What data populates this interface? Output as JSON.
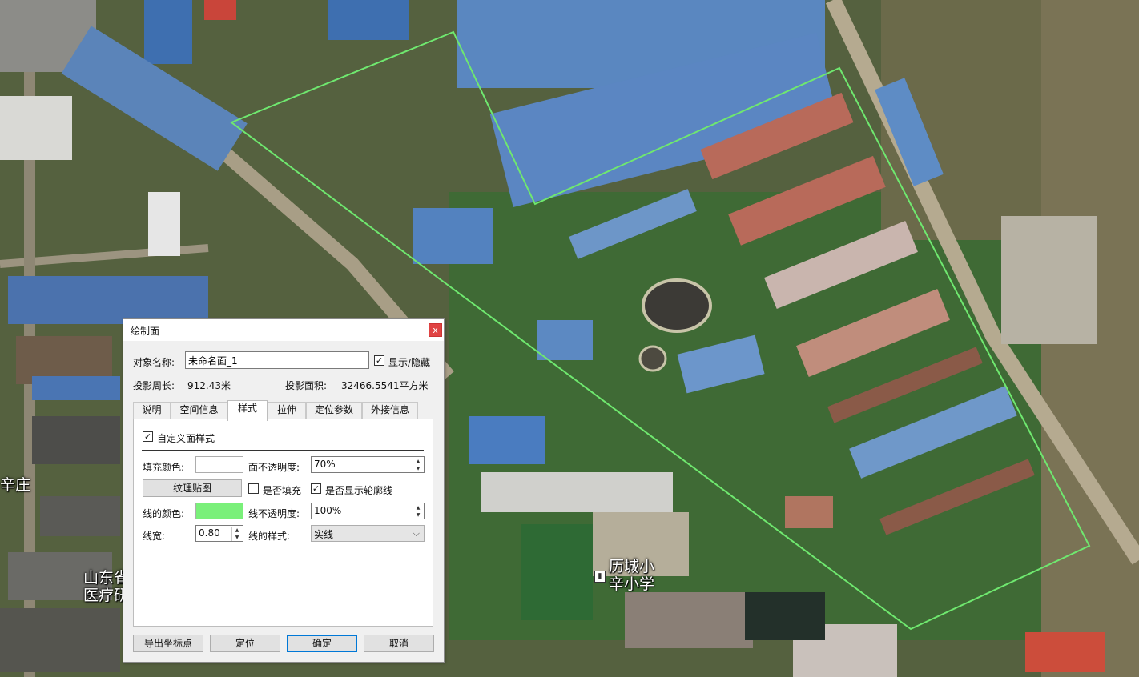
{
  "map": {
    "labels": {
      "school": "历城小\n辛小学",
      "left_place": "辛庄",
      "institute": "山东省\n医疗研"
    },
    "polygon_color": "#6fe86f"
  },
  "dialog": {
    "title": "绘制面",
    "close_label": "x",
    "name_label": "对象名称:",
    "name_value": "未命名面_1",
    "show_hide_label": "显示/隐藏",
    "perimeter_label": "投影周长:",
    "perimeter_value": "912.43米",
    "area_label": "投影面积:",
    "area_value": "32466.5541平方米",
    "tabs": [
      {
        "label": "说明"
      },
      {
        "label": "空间信息"
      },
      {
        "label": "样式"
      },
      {
        "label": "拉伸"
      },
      {
        "label": "定位参数"
      },
      {
        "label": "外接信息"
      }
    ],
    "active_tab": "样式",
    "style": {
      "custom_label": "自定义面样式",
      "fill_color_label": "填充颜色:",
      "fill_color": "#ffffff",
      "face_opacity_label": "面不透明度:",
      "face_opacity_value": "70%",
      "texture_button": "纹理贴图",
      "is_fill_label": "是否填充",
      "show_outline_label": "是否显示轮廓线",
      "line_color_label": "线的颜色:",
      "line_color": "#7af07a",
      "line_opacity_label": "线不透明度:",
      "line_opacity_value": "100%",
      "line_width_label": "线宽:",
      "line_width_value": "0.80",
      "line_style_label": "线的样式:",
      "line_style_value": "实线"
    },
    "buttons": {
      "export": "导出坐标点",
      "locate": "定位",
      "ok": "确定",
      "cancel": "取消"
    }
  }
}
